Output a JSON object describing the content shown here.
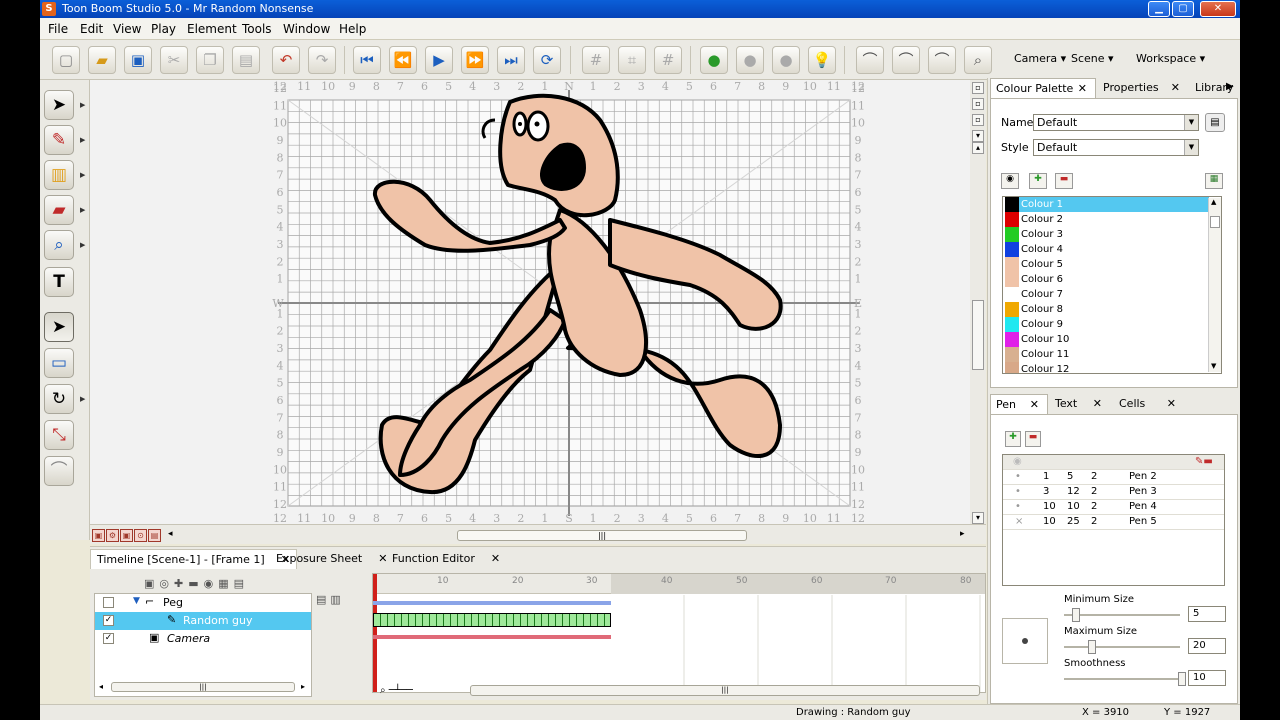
{
  "window": {
    "title": "Toon Boom Studio 5.0 - Mr Random Nonsense",
    "app_icon": "S",
    "minimize": "▁",
    "maximize": "▢",
    "close": "✕"
  },
  "menu": [
    "File",
    "Edit",
    "View",
    "Play",
    "Element",
    "Tools",
    "Window",
    "Help"
  ],
  "toolbar": {
    "camera": "Camera ▾",
    "scene": "Scene ▾",
    "workspace": "Workspace ▾"
  },
  "stage": {
    "numbers_left": [
      "12",
      "11",
      "10",
      "9",
      "8",
      "7",
      "6",
      "5",
      "4",
      "3",
      "2",
      "1",
      "",
      "1",
      "2",
      "3",
      "4",
      "5",
      "6",
      "7",
      "8",
      "9",
      "10",
      "11",
      "12"
    ],
    "numbers_top": [
      "12",
      "11",
      "10",
      "9",
      "8",
      "7",
      "6",
      "5",
      "4",
      "3",
      "2",
      "1",
      "N",
      "1",
      "2",
      "3",
      "4",
      "5",
      "6",
      "7",
      "8",
      "9",
      "10",
      "11",
      "12"
    ],
    "numbers_bottom": [
      "12",
      "11",
      "10",
      "9",
      "8",
      "7",
      "6",
      "5",
      "4",
      "3",
      "2",
      "1",
      "S",
      "1",
      "2",
      "3",
      "4",
      "5",
      "6",
      "7",
      "8",
      "9",
      "10",
      "11",
      "12"
    ],
    "west": "W",
    "east": "E",
    "character_colors": {
      "skin": "#f0c3a8",
      "outline": "#000000"
    }
  },
  "timeline": {
    "tabs": [
      "Timeline [Scene-1] - [Frame 1]",
      "Exposure Sheet",
      "Function Editor"
    ],
    "close": "✕",
    "layers": [
      {
        "name": "Peg",
        "checked": "",
        "icon": "⌐"
      },
      {
        "name": "Random guy",
        "checked": "✓",
        "icon": "✎"
      },
      {
        "name": "Camera",
        "checked": "✓",
        "icon": "▣"
      }
    ],
    "frame_ticks": [
      "10",
      "20",
      "30",
      "40",
      "50",
      "60",
      "70",
      "80"
    ],
    "scroll_grip": "|||"
  },
  "colour_palette": {
    "tabs": [
      "Colour Palette",
      "Properties",
      "Library"
    ],
    "name_label": "Name",
    "name_value": "Default",
    "style_label": "Style",
    "style_value": "Default",
    "colours": [
      {
        "name": "Colour 1",
        "hex": "#000000"
      },
      {
        "name": "Colour 2",
        "hex": "#dd0000"
      },
      {
        "name": "Colour 3",
        "hex": "#22cc22"
      },
      {
        "name": "Colour 4",
        "hex": "#1040e0"
      },
      {
        "name": "Colour 5",
        "hex": "#f0c3a8"
      },
      {
        "name": "Colour 6",
        "hex": "#f0c3a8"
      },
      {
        "name": "Colour 7",
        "hex": "#ffffff"
      },
      {
        "name": "Colour 8",
        "hex": "#f0a800"
      },
      {
        "name": "Colour 9",
        "hex": "#20e8f0"
      },
      {
        "name": "Colour 10",
        "hex": "#e020e8"
      },
      {
        "name": "Colour 11",
        "hex": "#d8b090"
      },
      {
        "name": "Colour 12",
        "hex": "#d8a888"
      }
    ]
  },
  "pen_panel": {
    "tabs": [
      "Pen",
      "Text",
      "Cells"
    ],
    "pens": [
      {
        "a": "1",
        "b": "5",
        "c": "2",
        "name": "Pen 2"
      },
      {
        "a": "3",
        "b": "12",
        "c": "2",
        "name": "Pen 3"
      },
      {
        "a": "10",
        "b": "10",
        "c": "2",
        "name": "Pen 4"
      },
      {
        "a": "10",
        "b": "25",
        "c": "2",
        "name": "Pen 5"
      }
    ],
    "min_label": "Minimum Size",
    "min_value": "5",
    "max_label": "Maximum Size",
    "max_value": "20",
    "smooth_label": "Smoothness",
    "smooth_value": "10"
  },
  "status": {
    "drawing": "Drawing : Random guy",
    "x": "X = 3910",
    "y": "Y = 1927"
  }
}
